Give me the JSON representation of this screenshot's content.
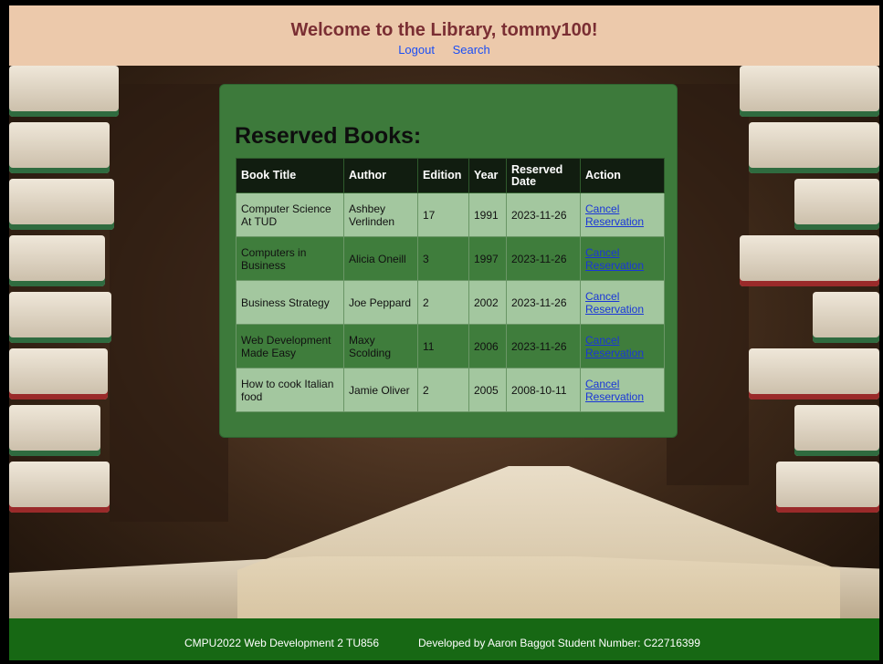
{
  "header": {
    "title": "Welcome to the Library, tommy100!",
    "nav": [
      {
        "label": "Logout"
      },
      {
        "label": "Search"
      }
    ]
  },
  "panel": {
    "heading": "Reserved Books:"
  },
  "table": {
    "columns": [
      "Book Title",
      "Author",
      "Edition",
      "Year",
      "Reserved Date",
      "Action"
    ],
    "rows": [
      {
        "title": "Computer Science At TUD",
        "author": "Ashbey Verlinden",
        "edition": "17",
        "year": "1991",
        "reserved": "2023-11-26",
        "action": "Cancel Reservation"
      },
      {
        "title": "Computers in Business",
        "author": "Alicia Oneill",
        "edition": "3",
        "year": "1997",
        "reserved": "2023-11-26",
        "action": "Cancel Reservation"
      },
      {
        "title": "Business Strategy",
        "author": "Joe Peppard",
        "edition": "2",
        "year": "2002",
        "reserved": "2023-11-26",
        "action": "Cancel Reservation"
      },
      {
        "title": "Web Development Made Easy",
        "author": "Maxy Scolding",
        "edition": "11",
        "year": "2006",
        "reserved": "2023-11-26",
        "action": "Cancel Reservation"
      },
      {
        "title": "How to cook Italian food",
        "author": "Jamie Oliver",
        "edition": "2",
        "year": "2005",
        "reserved": "2008-10-11",
        "action": "Cancel Reservation"
      }
    ]
  },
  "footer": {
    "course": "CMPU2022 Web Development 2 TU856",
    "developer": "Developed by Aaron Baggot Student Number: C22716399"
  },
  "colors": {
    "header_bg": "#ecc9ab",
    "title": "#7a2e33",
    "panel_bg": "#3d7a3b",
    "table_header": "#111d10",
    "row_light": "#a3c79f",
    "row_dark": "#3f7d3c",
    "footer_bg": "#176814",
    "link": "#1a36d8"
  },
  "icons": [
    "library-background-image"
  ]
}
